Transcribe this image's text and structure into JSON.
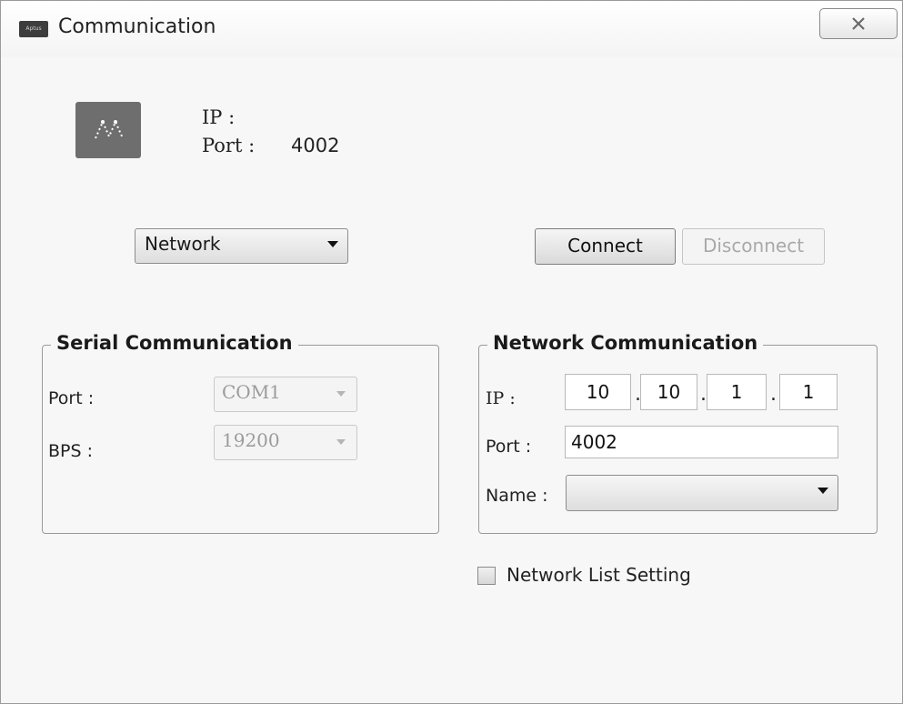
{
  "window": {
    "title": "Communication",
    "icon_text": "Aptus",
    "close_icon": "close-x-icon"
  },
  "info": {
    "logo_icon": "device-logo-icon",
    "ip_label": "IP :",
    "ip_value": "",
    "port_label": "Port :",
    "port_value": "4002"
  },
  "mode_select": {
    "value": "Network"
  },
  "actions": {
    "connect_label": "Connect",
    "disconnect_label": "Disconnect"
  },
  "serial": {
    "title": "Serial Communication",
    "port_label": "Port :",
    "port_value": "COM1",
    "bps_label": "BPS :",
    "bps_value": "19200"
  },
  "network": {
    "title": "Network Communication",
    "ip_label": "IP :",
    "ip_octets": [
      "10",
      "10",
      "1",
      "1"
    ],
    "port_label": "Port :",
    "port_value": "4002",
    "name_label": "Name :",
    "name_value": ""
  },
  "network_list": {
    "label": "Network List Setting",
    "checked": false
  },
  "colors": {
    "window_bg": "#f7f7f7",
    "logo_bg": "#6e6e6e",
    "disabled_text": "#a9a9a9"
  }
}
